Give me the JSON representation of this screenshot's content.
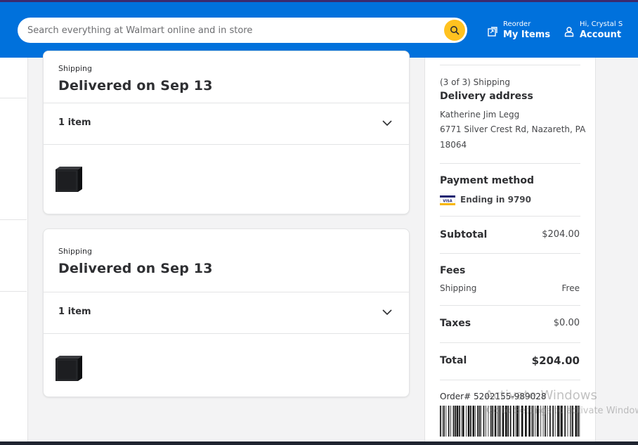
{
  "header": {
    "search_placeholder": "Search everything at Walmart online and in store",
    "reorder_small": "Reorder",
    "reorder_big": "My Items",
    "account_small": "Hi, Crystal S",
    "account_big": "Account"
  },
  "shipments": [
    {
      "label": "Shipping",
      "title": "Delivered on Sep 13",
      "items": "1 item"
    },
    {
      "label": "Shipping",
      "title": "Delivered on Sep 13",
      "items": "1 item"
    }
  ],
  "summary": {
    "shipping_count": "(3 of 3) Shipping",
    "delivery_heading": "Delivery address",
    "address_name": "Katherine Jim Legg",
    "address_line1": "6771 Silver Crest Rd, Nazareth, PA",
    "address_line2": "18064",
    "payment_heading": "Payment method",
    "card_brand": "VISA",
    "card_ending": "Ending in 9790",
    "subtotal_label": "Subtotal",
    "subtotal_value": "$204.00",
    "fees_label": "Fees",
    "shipping_fee_label": "Shipping",
    "shipping_fee_value": "Free",
    "taxes_label": "Taxes",
    "taxes_value": "$0.00",
    "total_label": "Total",
    "total_value": "$204.00",
    "order_number": "Order# 5202155-989028"
  },
  "watermark": {
    "line1": "Activate Windows",
    "line2": "Go to Settings to activate Windows."
  },
  "colors": {
    "brand_blue": "#0071dc",
    "spark_yellow": "#ffc220"
  }
}
